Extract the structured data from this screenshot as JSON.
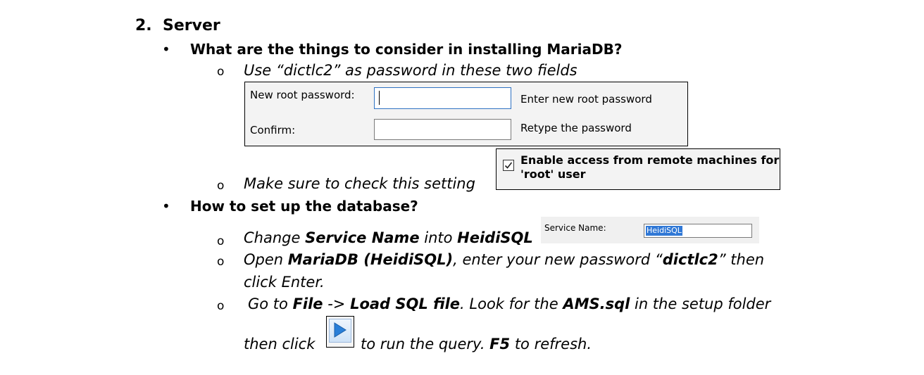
{
  "section": {
    "number": "2.",
    "title": "Server"
  },
  "bullet_glyph": "•",
  "ring_glyph": "o",
  "q1": {
    "title": "What are the things to consider in installing MariaDB?",
    "item1": "Use “dictlc2” as password in these two fields",
    "item2": "Make sure to check this setting"
  },
  "password_dialog": {
    "new_label": "New root password:",
    "new_hint": "Enter new root password",
    "confirm_label": "Confirm:",
    "confirm_hint": "Retype the password"
  },
  "remote_setting": {
    "line1": "Enable access from remote machines for",
    "line2": "'root' user",
    "checked": true
  },
  "q2": {
    "title": "How to set up the database?",
    "item1": {
      "a": "Change ",
      "b": "Service Name",
      "c": " into ",
      "d": "HeidiSQL"
    },
    "item2": {
      "a": "Open ",
      "b": "MariaDB (HeidiSQL)",
      "c": ", enter your new password “",
      "d": "dictlc2",
      "e": "” then",
      "f": "click Enter."
    },
    "item3": {
      "a": "Go to ",
      "b": "File",
      "c": " -> ",
      "d": "Load SQL file",
      "e": ". Look for the ",
      "f": "AMS.sql",
      "g": " in the setup folder",
      "h": "then click ",
      "i": " to run the query. ",
      "j": "F5",
      "k": " to refresh."
    }
  },
  "service_dialog": {
    "label": "Service Name:",
    "value": "HeidiSQL"
  },
  "icons": {
    "run": "run-query-icon",
    "check": "checkmark-icon"
  }
}
